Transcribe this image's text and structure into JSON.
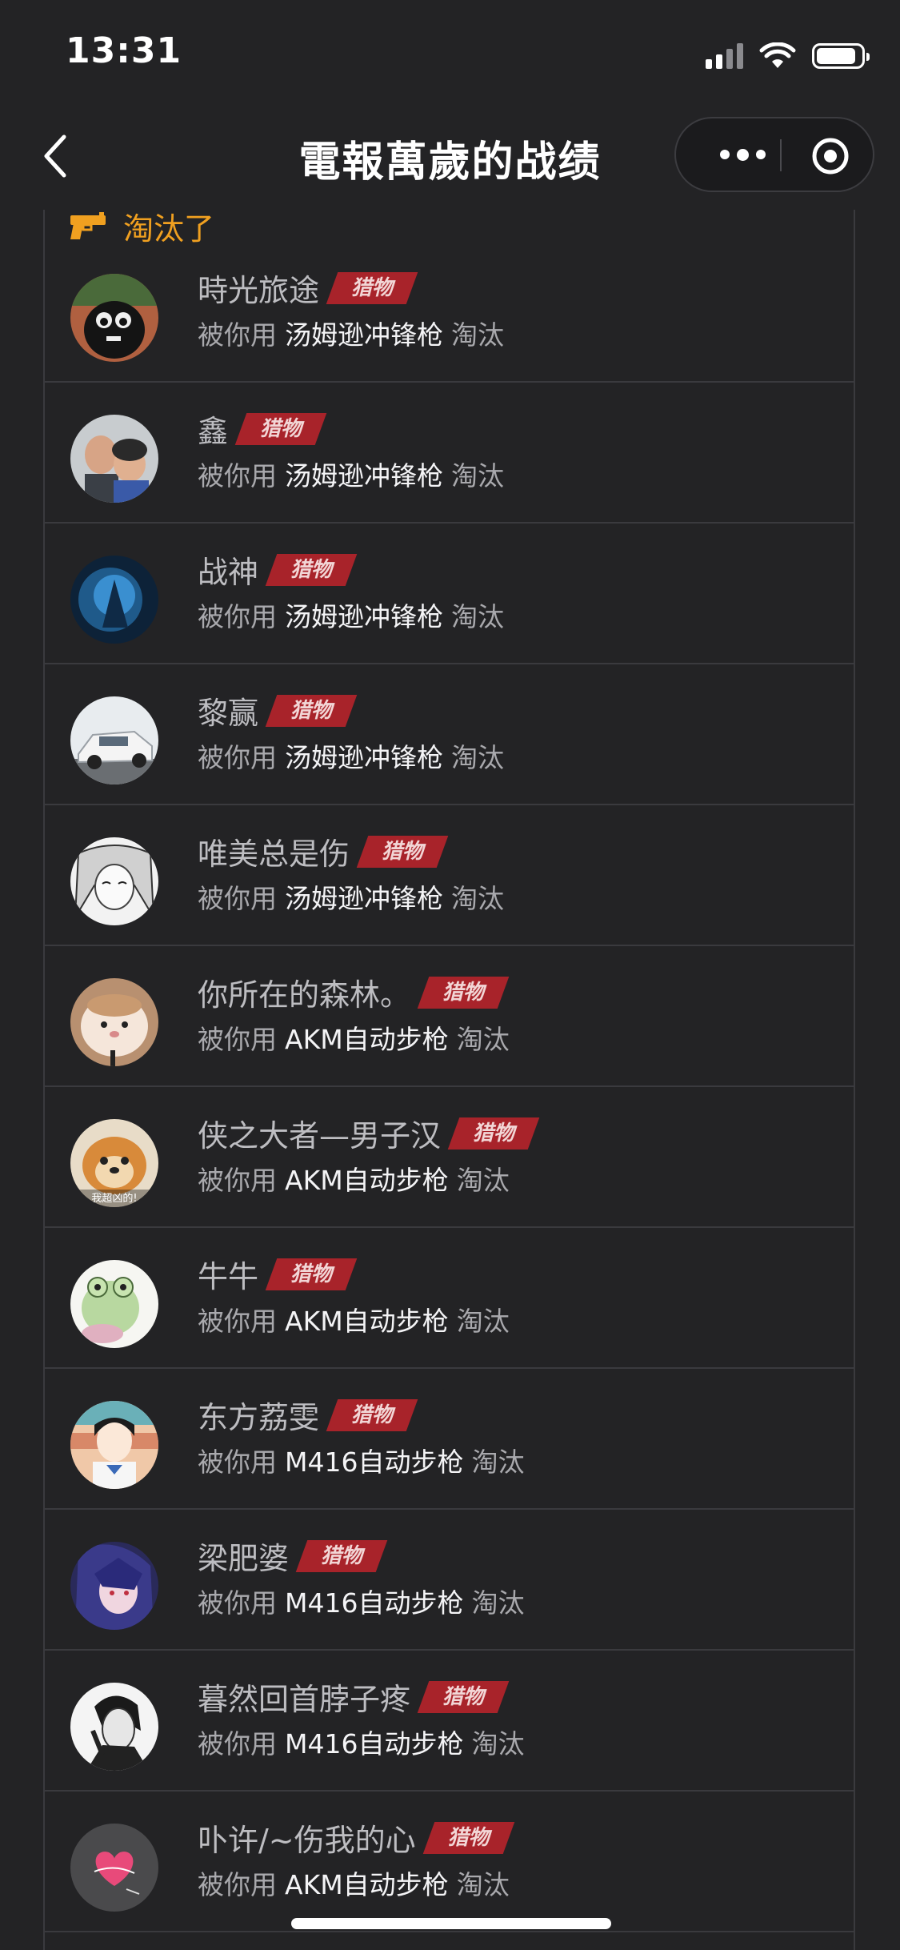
{
  "status_bar": {
    "time": "13:31"
  },
  "nav": {
    "title": "電報萬歲的战绩"
  },
  "section": {
    "title": "淘汰了"
  },
  "labels": {
    "by_you": "被你用",
    "eliminated": "淘汰",
    "prey_tag": "猎物"
  },
  "colors": {
    "accent": "#f0a020",
    "tag_bg": "#a8232a",
    "background": "#232325"
  },
  "rows": [
    {
      "name": "時光旅途",
      "weapon": "汤姆逊冲锋枪"
    },
    {
      "name": "鑫",
      "weapon": "汤姆逊冲锋枪"
    },
    {
      "name": "战神",
      "weapon": "汤姆逊冲锋枪"
    },
    {
      "name": "黎赢",
      "weapon": "汤姆逊冲锋枪"
    },
    {
      "name": "唯美总是伤",
      "weapon": "汤姆逊冲锋枪"
    },
    {
      "name": "你所在的森林。",
      "weapon": "AKM自动步枪"
    },
    {
      "name": "侠之大者—男子汉",
      "weapon": "AKM自动步枪"
    },
    {
      "name": "牛牛",
      "weapon": "AKM自动步枪"
    },
    {
      "name": "东方荔雯",
      "weapon": "M416自动步枪"
    },
    {
      "name": "梁肥婆",
      "weapon": "M416自动步枪"
    },
    {
      "name": "暮然回首脖子疼",
      "weapon": "M416自动步枪"
    },
    {
      "name": "卟许/~伤我的心",
      "weapon": "AKM自动步枪"
    }
  ],
  "avatar_texts": {
    "row7": "我超凶的!"
  }
}
